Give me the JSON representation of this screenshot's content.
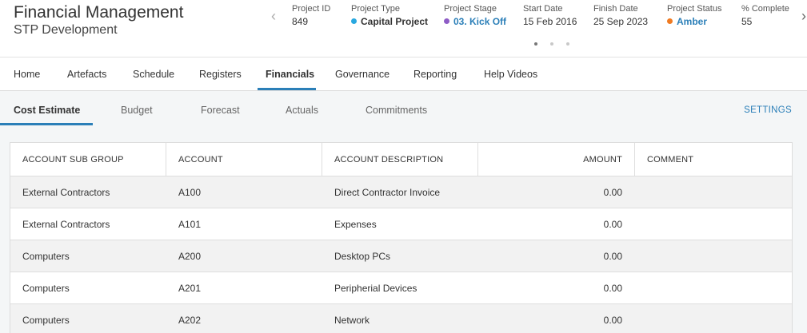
{
  "header": {
    "title": "Financial Management",
    "subtitle": "STP Development",
    "fields": [
      {
        "label": "Project ID",
        "value": "849"
      },
      {
        "label": "Project Type",
        "value": "Capital Project",
        "dot_color": "#29a8e0"
      },
      {
        "label": "Project Stage",
        "value": "03. Kick Off",
        "dot_color": "#8e5cc6"
      },
      {
        "label": "Start Date",
        "value": "15 Feb 2016"
      },
      {
        "label": "Finish Date",
        "value": "25 Sep 2023"
      },
      {
        "label": "Project Status",
        "value": "Amber",
        "dot_color": "#f07b22"
      },
      {
        "label": "% Complete",
        "value": "55"
      }
    ],
    "pager_active": 1
  },
  "nav": {
    "items": [
      "Home",
      "Artefacts",
      "Schedule",
      "Registers",
      "Financials",
      "Governance",
      "Reporting",
      "Help Videos"
    ],
    "active": "Financials"
  },
  "subnav": {
    "tabs": [
      "Cost Estimate",
      "Budget",
      "Forecast",
      "Actuals",
      "Commitments"
    ],
    "active": "Cost Estimate",
    "settings_label": "SETTINGS"
  },
  "table": {
    "columns": [
      "ACCOUNT SUB GROUP",
      "ACCOUNT",
      "ACCOUNT DESCRIPTION",
      "AMOUNT",
      "COMMENT"
    ],
    "rows": [
      [
        "External Contractors",
        "A100",
        "Direct Contractor Invoice",
        "0.00",
        ""
      ],
      [
        "External Contractors",
        "A101",
        "Expenses",
        "0.00",
        ""
      ],
      [
        "Computers",
        "A200",
        "Desktop PCs",
        "0.00",
        ""
      ],
      [
        "Computers",
        "A201",
        "Peripherial Devices",
        "0.00",
        ""
      ],
      [
        "Computers",
        "A202",
        "Network",
        "0.00",
        ""
      ]
    ]
  },
  "colors": {
    "accent": "#2b7fb8"
  }
}
